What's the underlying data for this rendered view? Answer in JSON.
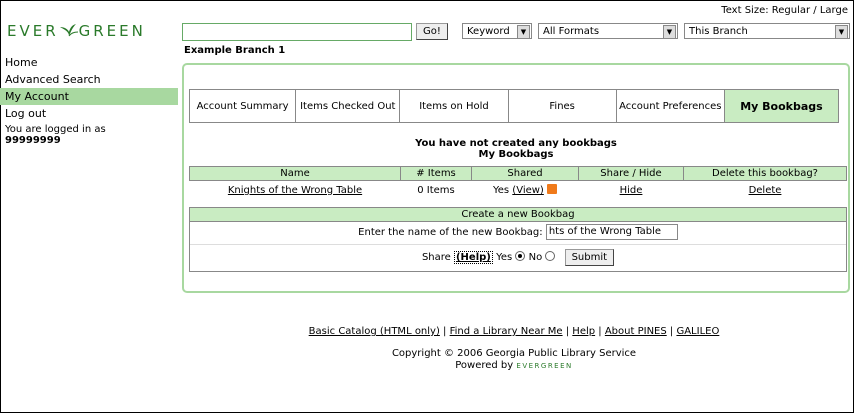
{
  "header": {
    "text_size": "Text Size: Regular / Large",
    "logo_left": "EVER",
    "logo_right": "GREEN",
    "search_value": "",
    "go_label": "Go!",
    "search_type": "Keyword",
    "format": "All Formats",
    "scope": "This Branch"
  },
  "sidebar": {
    "items": [
      "Home",
      "Advanced Search",
      "My Account",
      "Log out"
    ],
    "login_label": "You are logged in as",
    "login_user": "99999999"
  },
  "branch": "Example Branch 1",
  "tabs": [
    "Account Summary",
    "Items Checked Out",
    "Items on Hold",
    "Fines",
    "Account Preferences",
    "My Bookbags"
  ],
  "message": {
    "line1": "You have not created any bookbags",
    "line2": "My Bookbags"
  },
  "bookbag_table": {
    "headers": [
      "Name",
      "# Items",
      "Shared",
      "Share / Hide",
      "Delete this bookbag?"
    ],
    "row": {
      "name": "Knights of the Wrong Table",
      "items": "0 Items",
      "shared_yes": "Yes",
      "view": "(View)",
      "hide": "Hide",
      "delete": "Delete"
    }
  },
  "create": {
    "title": "Create a new Bookbag",
    "name_label": "Enter the name of the new Bookbag:",
    "name_value": "hts of the Wrong Table",
    "share_label": "Share",
    "help": "(Help)",
    "yes": "Yes",
    "no": "No",
    "submit": "Submit"
  },
  "footer": {
    "links": [
      "Basic Catalog (HTML only)",
      "Find a Library Near Me",
      "Help",
      "About PINES",
      "GALILEO"
    ],
    "copyright": "Copyright © 2006 Georgia Public Library Service",
    "powered": "Powered by",
    "powered_logo": "EVERGREEN"
  },
  "colors": {
    "accent_green": "#a8d8a0",
    "header_green": "#c9ecc2",
    "logo_green": "#2a7a2a",
    "rss_orange": "#f07a1a"
  }
}
